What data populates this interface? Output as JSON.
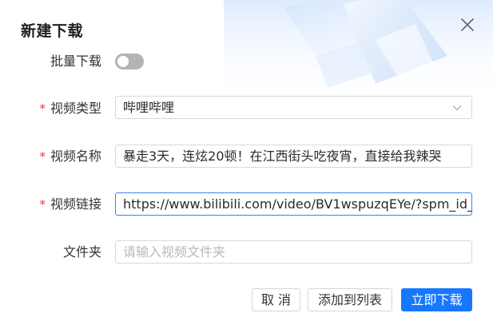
{
  "dialog": {
    "title": "新建下载"
  },
  "form": {
    "batch": {
      "label": "批量下载",
      "enabled": false
    },
    "video_type": {
      "label": "视频类型",
      "required_mark": "*",
      "value": "哔哩哔哩"
    },
    "video_name": {
      "label": "视频名称",
      "required_mark": "*",
      "value": "暴走3天，连炫20顿！在江西街头吃夜宵，直接给我辣哭"
    },
    "video_link": {
      "label": "视频链接",
      "required_mark": "*",
      "value": "https://www.bilibili.com/video/BV1wspuzqEYe/?spm_id_"
    },
    "folder": {
      "label": "文件夹",
      "value": "",
      "placeholder": "请输入视频文件夹"
    }
  },
  "actions": {
    "cancel_label": "取 消",
    "add_to_list_label": "添加到列表",
    "download_now_label": "立即下载"
  },
  "colors": {
    "primary": "#1677ff",
    "required": "#e23b3b",
    "focus_border": "#3b82f6"
  }
}
